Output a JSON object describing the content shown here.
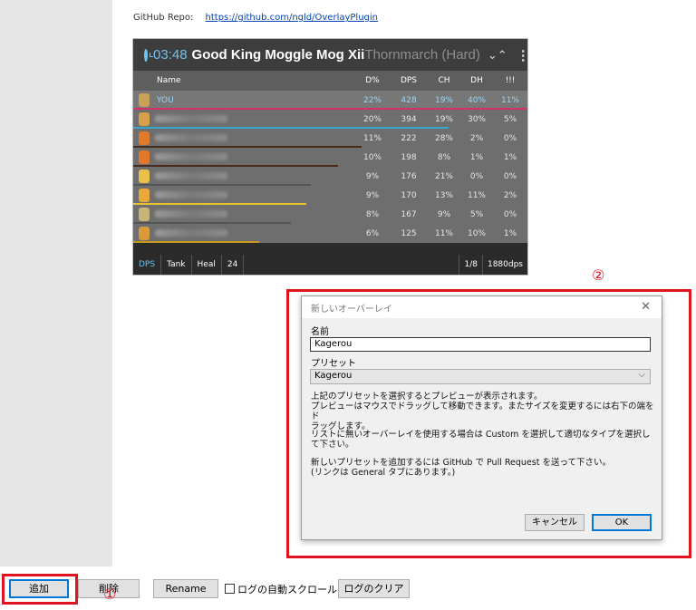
{
  "repo": {
    "label": "GitHub Repo:",
    "link": "https://github.com/ngld/OverlayPlugin"
  },
  "overlay": {
    "time": "03:48",
    "title": "Good King Moggle Mog Xii",
    "zone": "Thornmarch (Hard)",
    "collapse_icon": "⌄⌃",
    "menu_icon": "⋮",
    "columns": [
      "Name",
      "D%",
      "DPS",
      "CH",
      "DH",
      "!!!"
    ],
    "rows": [
      {
        "name": "YOU",
        "d": "22%",
        "dps": "428",
        "ch": "19%",
        "dh": "40%",
        "x": "11%",
        "icon_color": "#c9a25a",
        "bar_color": "#d6306a"
      },
      {
        "name": "",
        "d": "20%",
        "dps": "394",
        "ch": "19%",
        "dh": "30%",
        "x": "5%",
        "icon_color": "#d7a04a",
        "bar_color": "#3aa6c9"
      },
      {
        "name": "",
        "d": "11%",
        "dps": "222",
        "ch": "28%",
        "dh": "2%",
        "x": "0%",
        "icon_color": "#e07a2a",
        "bar_color": "#4a2a1a"
      },
      {
        "name": "",
        "d": "10%",
        "dps": "198",
        "ch": "8%",
        "dh": "1%",
        "x": "1%",
        "icon_color": "#e07a2a",
        "bar_color": "#4a2a1a"
      },
      {
        "name": "",
        "d": "9%",
        "dps": "176",
        "ch": "21%",
        "dh": "0%",
        "x": "0%",
        "icon_color": "#e8c04a",
        "bar_color": "#555555"
      },
      {
        "name": "",
        "d": "9%",
        "dps": "170",
        "ch": "13%",
        "dh": "11%",
        "x": "2%",
        "icon_color": "#e8a83a",
        "bar_color": "#e8c030"
      },
      {
        "name": "",
        "d": "8%",
        "dps": "167",
        "ch": "9%",
        "dh": "5%",
        "x": "0%",
        "icon_color": "#c8b478",
        "bar_color": "#555555"
      },
      {
        "name": "",
        "d": "6%",
        "dps": "125",
        "ch": "11%",
        "dh": "10%",
        "x": "1%",
        "icon_color": "#d89a3a",
        "bar_color": "#c89a1a"
      }
    ],
    "tabs": [
      "DPS",
      "Tank",
      "Heal",
      "24"
    ],
    "page": "1/8",
    "total_dps": "1880dps"
  },
  "markers": {
    "one": "①",
    "two": "②"
  },
  "dialog": {
    "title": "新しいオーバーレイ",
    "close": "✕",
    "name_label": "名前",
    "name_value": "Kagerou",
    "preset_label": "プリセット",
    "preset_value": "Kagerou",
    "preset_chevron": "⌵",
    "help1_line1": "上記のプリセットを選択するとプレビューが表示されます。",
    "help1_line2": "プレビューはマウスでドラッグして移動できます。またサイズを変更するには右下の端をド",
    "help1_line3": "ラッグします。",
    "help2_line1": "リストに無いオーバーレイを使用する場合は Custom を選択して適切なタイプを選択し",
    "help2_line2": "て下さい。",
    "help3_line1": "新しいプリセットを追加するには GitHub で Pull Request を送って下さい。",
    "help3_line2": "(リンクは General タブにあります。)",
    "cancel": "キャンセル",
    "ok": "OK"
  },
  "bottom": {
    "add": "追加",
    "delete": "削除",
    "rename": "Rename",
    "autoscroll": "ログの自動スクロール",
    "clear": "ログのクリア"
  },
  "colors": {
    "highlight": "#e0141e",
    "accent": "#6fc3ef"
  }
}
